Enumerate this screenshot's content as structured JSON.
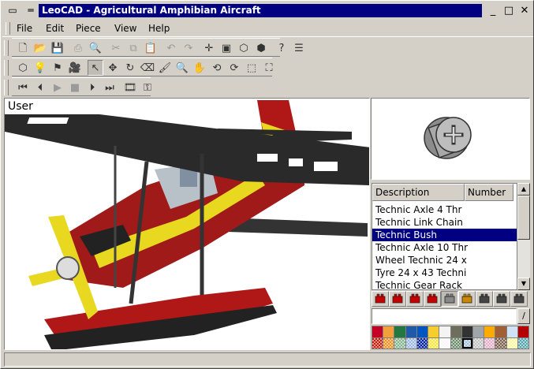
{
  "window": {
    "title": "LeoCAD - Agricultural Amphibian Aircraft",
    "system_menu_glyph": "▭",
    "controls": {
      "minimize": "_",
      "maximize": "□",
      "close": "✕"
    }
  },
  "menu": {
    "items": [
      "File",
      "Edit",
      "Piece",
      "View",
      "Help"
    ]
  },
  "toolbars": {
    "standard": [
      {
        "icon": "new-file-icon",
        "glyph": "🗋"
      },
      {
        "icon": "open-folder-icon",
        "glyph": "📂"
      },
      {
        "icon": "save-icon",
        "glyph": "💾"
      },
      {
        "icon": "print-icon",
        "glyph": "⎙",
        "disabled": true
      },
      {
        "icon": "print-preview-icon",
        "glyph": "🔍",
        "disabled": true
      },
      {
        "icon": "cut-icon",
        "glyph": "✂",
        "disabled": true
      },
      {
        "icon": "copy-icon",
        "glyph": "⧉",
        "disabled": true
      },
      {
        "icon": "paste-icon",
        "glyph": "📋"
      },
      {
        "icon": "undo-icon",
        "glyph": "↶",
        "disabled": true
      },
      {
        "icon": "redo-icon",
        "glyph": "↷",
        "disabled": true
      },
      {
        "icon": "snap-icon",
        "glyph": "✛"
      },
      {
        "icon": "lock-axis-icon",
        "glyph": "▣"
      },
      {
        "icon": "move-snap-icon",
        "glyph": "⬡"
      },
      {
        "icon": "piece-library-icon",
        "glyph": "⬢"
      },
      {
        "icon": "help-icon",
        "glyph": "?"
      },
      {
        "icon": "properties-icon",
        "glyph": "☰"
      }
    ],
    "tools": [
      {
        "icon": "add-piece-icon",
        "glyph": "⬡"
      },
      {
        "icon": "light-icon",
        "glyph": "💡"
      },
      {
        "icon": "spotlight-icon",
        "glyph": "⚑"
      },
      {
        "icon": "camera-icon",
        "glyph": "🎥"
      },
      {
        "icon": "select-arrow-icon",
        "glyph": "↖",
        "active": true
      },
      {
        "icon": "move-icon",
        "glyph": "✥"
      },
      {
        "icon": "rotate-icon",
        "glyph": "↻"
      },
      {
        "icon": "eraser-icon",
        "glyph": "⌫"
      },
      {
        "icon": "paint-icon",
        "glyph": "🖌"
      },
      {
        "icon": "zoom-icon",
        "glyph": "🔍"
      },
      {
        "icon": "pan-icon",
        "glyph": "✋"
      },
      {
        "icon": "rotate-view-icon",
        "glyph": "⟲"
      },
      {
        "icon": "roll-icon",
        "glyph": "⟳"
      },
      {
        "icon": "zoom-region-icon",
        "glyph": "⬚"
      },
      {
        "icon": "zoom-extents-icon",
        "glyph": "⛶"
      }
    ],
    "animation": [
      {
        "icon": "first-frame-icon",
        "glyph": "⏮"
      },
      {
        "icon": "previous-frame-icon",
        "glyph": "⏴"
      },
      {
        "icon": "play-icon",
        "glyph": "▶",
        "disabled": true
      },
      {
        "icon": "stop-icon",
        "glyph": "■",
        "disabled": true
      },
      {
        "icon": "next-frame-icon",
        "glyph": "⏵"
      },
      {
        "icon": "last-frame-icon",
        "glyph": "⏭"
      },
      {
        "icon": "animation-mode-icon",
        "glyph": "🎞"
      },
      {
        "icon": "add-keys-icon",
        "glyph": "⚿"
      }
    ]
  },
  "viewport": {
    "label": "User"
  },
  "piece_list": {
    "columns": [
      "Description",
      "Number"
    ],
    "rows": [
      {
        "description": "Technic Axle  4 Thr",
        "selected": false
      },
      {
        "description": "Technic Link Chain",
        "selected": false
      },
      {
        "description": "Technic Bush",
        "selected": true
      },
      {
        "description": "Technic Axle 10 Thr",
        "selected": false
      },
      {
        "description": "Wheel Technic 24 x",
        "selected": false
      },
      {
        "description": "Tyre 24 x 43 Techni",
        "selected": false
      },
      {
        "description": "Technic Gear Rack",
        "selected": false
      }
    ]
  },
  "categories": [
    {
      "icon": "brick-icon",
      "color": "#c80000"
    },
    {
      "icon": "plate-icon",
      "color": "#c80000"
    },
    {
      "icon": "slope-icon",
      "color": "#c80000"
    },
    {
      "icon": "special-brick-icon",
      "color": "#c80000"
    },
    {
      "icon": "technic-icon",
      "color": "#888888",
      "active": true
    },
    {
      "icon": "accessory-icon",
      "color": "#cc8800"
    },
    {
      "icon": "baseplate-icon",
      "color": "#444444"
    },
    {
      "icon": "train-icon",
      "color": "#444444"
    },
    {
      "icon": "minifig-icon",
      "color": "#444444"
    }
  ],
  "search": {
    "value": "",
    "button_glyph": "/"
  },
  "palette": {
    "solid": [
      "#c40026",
      "#f2a03a",
      "#237841",
      "#1e5aa8",
      "#0055bf",
      "#f5cd2f",
      "#f2f3f2",
      "#6d6e5c",
      "#333333",
      "#a0a5a9",
      "#fcac00",
      "#a05f35",
      "#cfe2f7",
      "#b40000"
    ],
    "transparent": [
      "#c91a09",
      "#f08f1c",
      "#84b68d",
      "#9bb9e0",
      "#0020a0",
      "#f5e53a",
      "#f8f8f8",
      "#6a8c6a",
      "#a3c2d7",
      "#c0c0c0",
      "#e4adc8",
      "#7a5c4a",
      "#f7f6a0",
      "#55a5af"
    ],
    "selected_transparent_index": 8
  },
  "status": {
    "text": ""
  }
}
